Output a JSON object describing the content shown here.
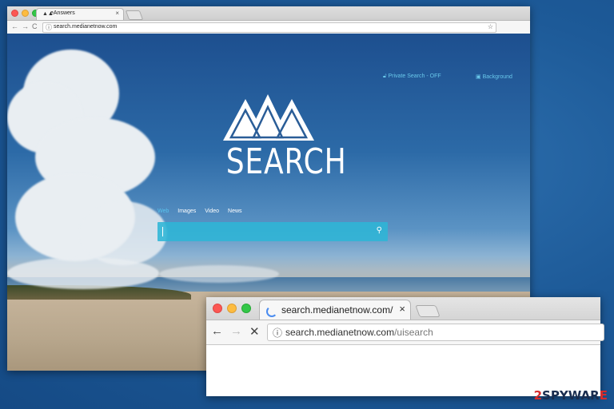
{
  "main_window": {
    "tab_title": "eAnswers",
    "tab_close": "×",
    "url": "search.medianetnow.com",
    "nav": {
      "back": "←",
      "forward": "→",
      "reload": "C"
    },
    "bookmark_icon": "star-icon",
    "page": {
      "private_search": "Private Search - OFF",
      "background": "Background",
      "logo_text": "SEARCH",
      "search_tabs": [
        "Web",
        "Images",
        "Video",
        "News"
      ],
      "search_value": "",
      "search_icon": "magnifier-icon"
    }
  },
  "zoom_window": {
    "tab_title": "search.medianetnow.com/uisearch",
    "tab_close": "×",
    "url_host": "search.medianetnow.com",
    "url_path": "/uisearch",
    "nav": {
      "back": "←",
      "forward": "→",
      "stop": "✕"
    }
  },
  "watermark": {
    "prefix": "2",
    "brand": "SPYWAR",
    "suffix": "E"
  },
  "colors": {
    "accent": "#2eb5d6",
    "link": "#68c7ea",
    "desktop": "#1d5a98"
  }
}
